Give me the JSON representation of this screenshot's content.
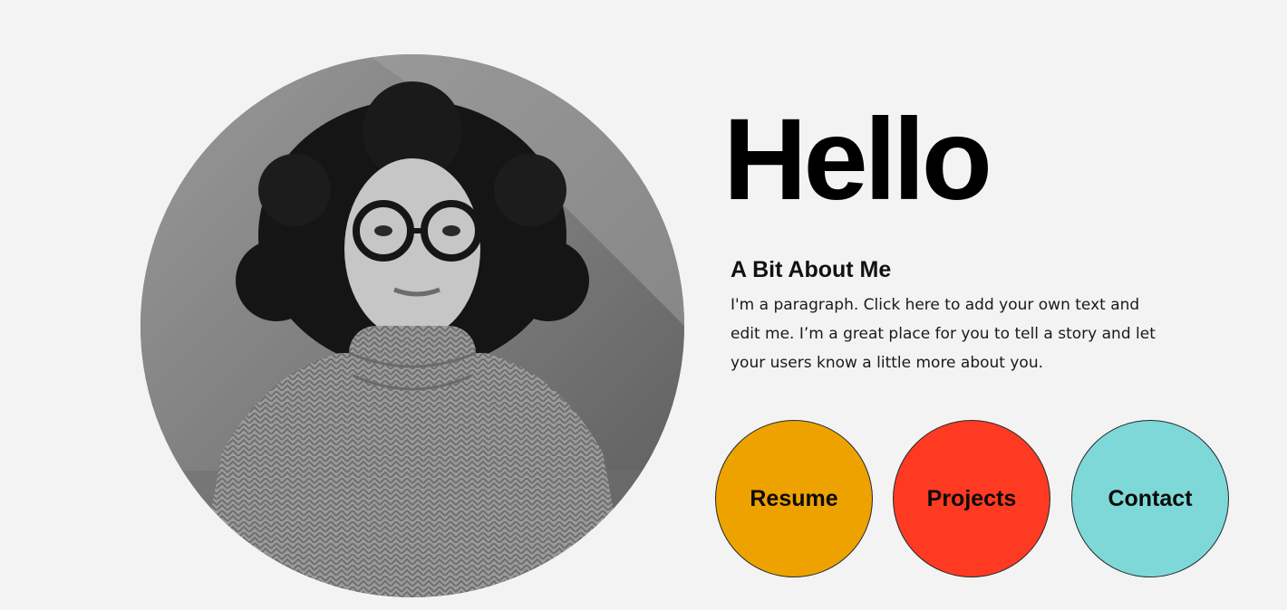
{
  "hero": {
    "heading": "Hello",
    "about_title": "A Bit About Me",
    "about_text": "I'm a paragraph. Click here to add your own text and edit me. I’m a great place for you to tell a story and let your users know a little more about you."
  },
  "nav_buttons": [
    {
      "label": "Resume",
      "color": "#EEA200"
    },
    {
      "label": "Projects",
      "color": "#FF3A22"
    },
    {
      "label": "Contact",
      "color": "#7FD8D8"
    }
  ],
  "colors": {
    "background": "#F3F3F3",
    "text": "#000000"
  },
  "portrait": {
    "icon": "profile-photo"
  }
}
